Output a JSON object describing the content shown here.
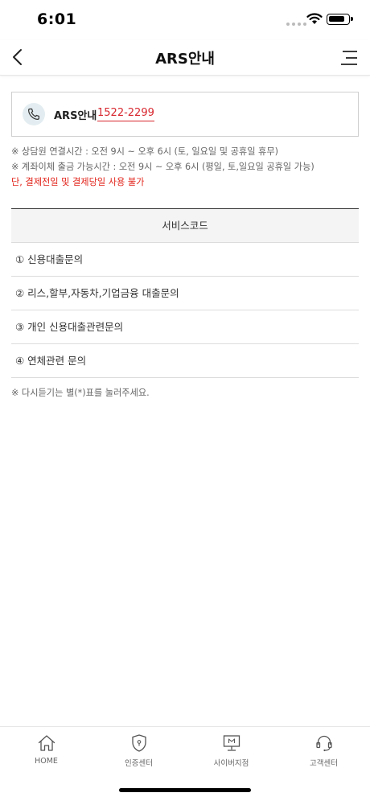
{
  "status": {
    "time": "6:01"
  },
  "nav": {
    "title": "ARS안내"
  },
  "ars": {
    "label": "ARS안내",
    "number": "1522-2299"
  },
  "notes": [
    "※ 상담원 연결시간 : 오전 9시 ~ 오후 6시 (토, 일요일 및 공휴일 휴무)",
    "※ 계좌이체 출금 가능시간 : 오전 9시 ~ 오후 6시 (평일, 토,일요일 공휴일 가능)",
    "단, 결제전일 및 결제당일 사용 불가"
  ],
  "service_table": {
    "header": "서비스코드",
    "rows": [
      "① 신용대출문의",
      "② 리스,할부,자동차,기업금융 대출문의",
      "③ 개인 신용대출관련문의",
      "④ 연체관련 문의"
    ],
    "note": "※ 다시듣기는 별(*)표를 눌러주세요."
  },
  "tabs": [
    {
      "label": "HOME",
      "icon": "home-icon"
    },
    {
      "label": "인증센터",
      "icon": "shield-icon"
    },
    {
      "label": "사이버지점",
      "icon": "monitor-icon"
    },
    {
      "label": "고객센터",
      "icon": "headset-icon"
    }
  ],
  "colors": {
    "accent_red": "#d7262e",
    "phone_circle": "#e3edf1"
  }
}
